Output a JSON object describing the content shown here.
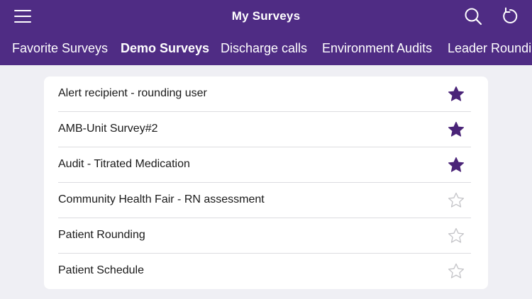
{
  "header": {
    "title": "My Surveys",
    "menu_icon": "hamburger-menu-icon",
    "search_icon": "search-icon",
    "refresh_icon": "refresh-icon"
  },
  "tabs": [
    {
      "label": "Favorite Surveys",
      "active": false
    },
    {
      "label": "Demo Surveys",
      "active": true
    },
    {
      "label": "Discharge calls",
      "active": false
    },
    {
      "label": "Environment Audits",
      "active": false
    },
    {
      "label": "Leader Roundi",
      "active": false
    }
  ],
  "surveys": [
    {
      "name": "Alert recipient - rounding user",
      "favorite": true
    },
    {
      "name": "AMB-Unit Survey#2",
      "favorite": true
    },
    {
      "name": "Audit - Titrated Medication",
      "favorite": true
    },
    {
      "name": "Community Health Fair - RN assessment",
      "favorite": false
    },
    {
      "name": "Patient Rounding",
      "favorite": false
    },
    {
      "name": "Patient Schedule",
      "favorite": false
    }
  ],
  "colors": {
    "brand": "#4f2c84",
    "star_filled": "#4a2478",
    "star_outline": "#c4c4c8",
    "background": "#efeff4"
  }
}
